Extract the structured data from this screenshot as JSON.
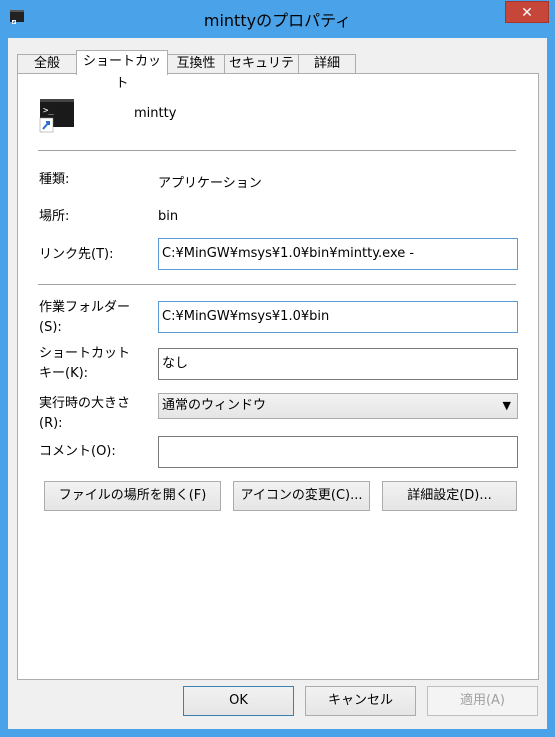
{
  "window": {
    "title": "minttyのプロパティ",
    "close_label": "✕"
  },
  "tabs": [
    "全般",
    "ショートカット",
    "互換性",
    "セキュリティ",
    "詳細"
  ],
  "shortcut": {
    "name": "mintty",
    "type_label": "種類:",
    "type_value": "アプリケーション",
    "location_label": "場所:",
    "location_value": "bin",
    "target_label": "リンク先(T):",
    "target_value": "C:¥MinGW¥msys¥1.0¥bin¥mintty.exe -",
    "startin_label": "作業フォルダー(S):",
    "startin_value": "C:¥MinGW¥msys¥1.0¥bin",
    "hotkey_label": "ショートカットキー(K):",
    "hotkey_value": "なし",
    "run_label": "実行時の大きさ(R):",
    "run_value": "通常のウィンドウ",
    "comment_label": "コメント(O):",
    "comment_value": "",
    "open_location_button": "ファイルの場所を開く(F)",
    "change_icon_button": "アイコンの変更(C)...",
    "advanced_button": "詳細設定(D)..."
  },
  "footer": {
    "ok": "OK",
    "cancel": "キャンセル",
    "apply": "適用(A)"
  },
  "colors": {
    "title_bar": "#4aa3e8",
    "close": "#c7463a",
    "focus_border": "#5b9bd5"
  }
}
